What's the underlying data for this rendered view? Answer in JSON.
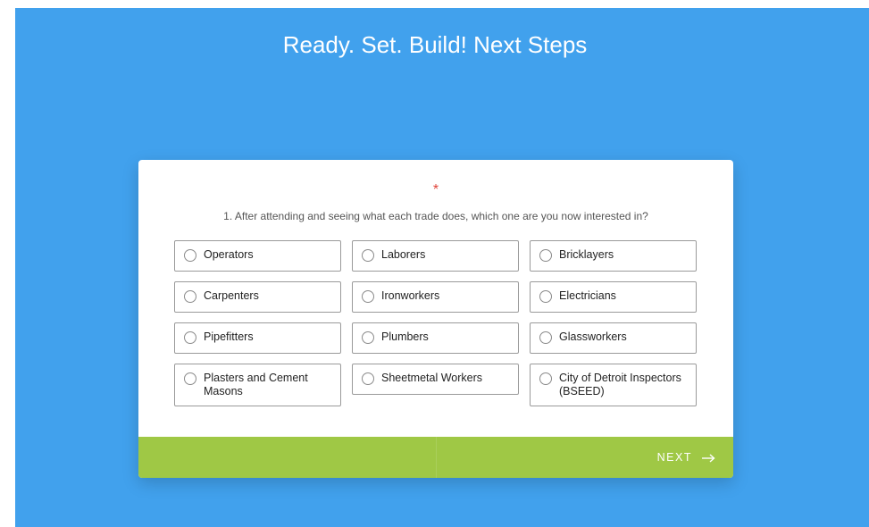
{
  "header": {
    "title": "Ready. Set. Build! Next Steps"
  },
  "question": {
    "required_mark": "*",
    "text": "1. After attending and seeing what each trade does, which one are you now interested in?",
    "options": [
      {
        "label": "Operators"
      },
      {
        "label": "Laborers"
      },
      {
        "label": "Bricklayers"
      },
      {
        "label": "Carpenters"
      },
      {
        "label": "Ironworkers"
      },
      {
        "label": "Electricians"
      },
      {
        "label": "Pipefitters"
      },
      {
        "label": "Plumbers"
      },
      {
        "label": "Glassworkers"
      },
      {
        "label": "Plasters and Cement Masons"
      },
      {
        "label": "Sheetmetal Workers"
      },
      {
        "label": "City of Detroit Inspectors (BSEED)"
      }
    ]
  },
  "footer": {
    "next_label": "NEXT",
    "next_icon": "arrow-right-icon"
  },
  "colors": {
    "background": "#41a1ed",
    "footer": "#9fc845",
    "required": "#e0443a"
  }
}
